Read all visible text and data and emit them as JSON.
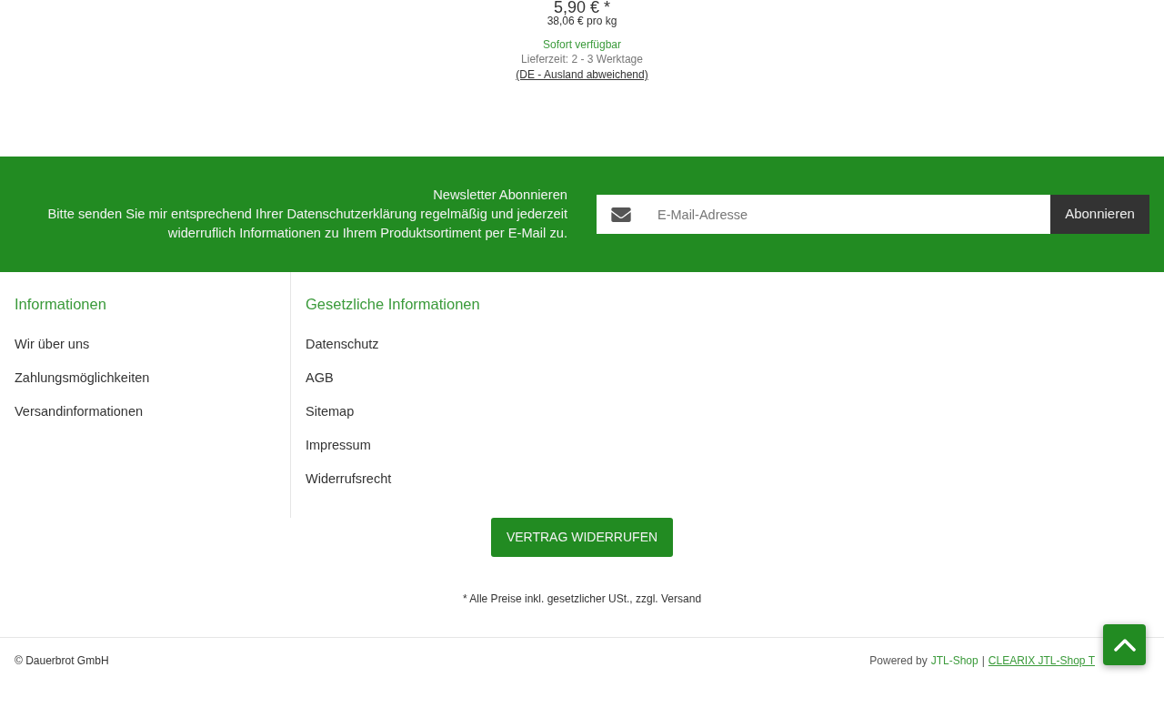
{
  "product": {
    "price": "5,90 € *",
    "unit_price": "38,06 € pro kg",
    "availability": "Sofort verfügbar",
    "delivery_time": "Lieferzeit: 2 - 3 Werktage",
    "delivery_note_link": "(DE - Ausland abweichend)"
  },
  "newsletter": {
    "title": "Newsletter Abonnieren",
    "description": "Bitte senden Sie mir entsprechend Ihrer Datenschutzerklärung regelmäßig und jederzeit widerruflich Informationen zu Ihrem Produktsortiment per E-Mail zu.",
    "email_field": {
      "placeholder": "E-Mail-Adresse"
    },
    "subscribe_button": "Abonnieren"
  },
  "footer_columns": [
    {
      "heading": "Informationen",
      "links": [
        "Wir über uns",
        "Zahlungsmöglichkeiten",
        "Versandinformationen"
      ]
    },
    {
      "heading": "Gesetzliche Informationen",
      "links": [
        "Datenschutz",
        "AGB",
        "Sitemap",
        "Impressum",
        "Widerrufsrecht"
      ]
    }
  ],
  "withdraw_button": "VERTRAG WIDERRUFEN",
  "price_note": "* Alle Preise inkl. gesetzlicher USt., zzgl. Versand",
  "bottom_bar": {
    "copyright": "© Dauerbrot GmbH",
    "powered_by": "Powered by",
    "separator": "|",
    "links": [
      {
        "label": "JTL-Shop",
        "kind": "plain"
      },
      {
        "label": "CLEARIX JTL-Shop T",
        "kind": "underlined"
      }
    ]
  }
}
